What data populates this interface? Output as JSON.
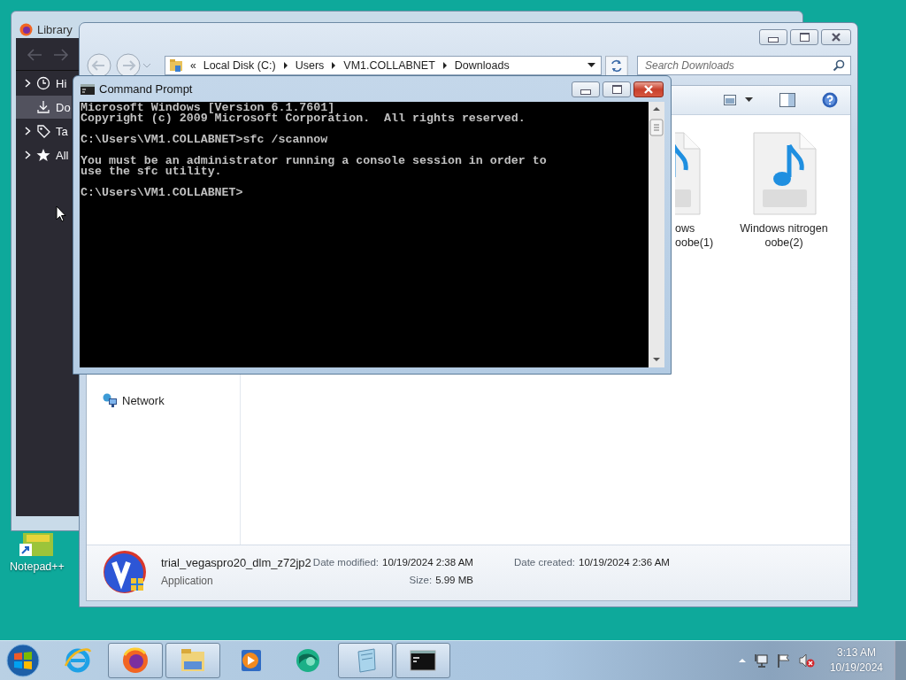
{
  "library_window": {
    "title": "Library",
    "sidebar": {
      "items": [
        {
          "label": "Hi",
          "expandable": true,
          "selected": false
        },
        {
          "label": "Do",
          "expandable": false,
          "selected": true
        },
        {
          "label": "Ta",
          "expandable": true,
          "selected": false
        },
        {
          "label": "All",
          "expandable": true,
          "selected": false
        }
      ]
    }
  },
  "explorer_window": {
    "address_bar": {
      "overflow": "«",
      "crumbs": [
        "Local Disk (C:)",
        "Users",
        "VM1.COLLABNET",
        "Downloads"
      ]
    },
    "search": {
      "placeholder": "Search Downloads"
    },
    "navigation_pane": {
      "items": [
        {
          "label": "Network"
        }
      ]
    },
    "files": [
      {
        "label": "ows oobe(1)"
      },
      {
        "label": "Windows nitrogen oobe(2)"
      }
    ],
    "details_pane": {
      "name": "trial_vegaspro20_dlm_z72jp2",
      "type": "Application",
      "properties": [
        {
          "label": "Date modified:",
          "value": "10/19/2024 2:38 AM"
        },
        {
          "label": "Size:",
          "value": "5.99 MB"
        },
        {
          "label": "Date created:",
          "value": "10/19/2024 2:36 AM"
        }
      ]
    }
  },
  "command_prompt_window": {
    "title": "Command Prompt",
    "console_blocks": [
      [
        "Microsoft Windows [Version 6.1.7601]",
        "Copyright (c) 2009 Microsoft Corporation.  All rights reserved."
      ],
      [
        "C:\\Users\\VM1.COLLABNET>sfc /scannow"
      ],
      [
        "You must be an administrator running a console session in order to",
        "use the sfc utility."
      ],
      [
        "C:\\Users\\VM1.COLLABNET>"
      ]
    ]
  },
  "desktop": {
    "icons": [
      {
        "label": "Notepad++"
      }
    ]
  },
  "taskbar": {
    "items": [
      {
        "running": false
      },
      {
        "running": true
      },
      {
        "running": true
      },
      {
        "running": false
      },
      {
        "running": false
      },
      {
        "running": true
      },
      {
        "running": true
      }
    ],
    "clock": {
      "time": "3:13 AM",
      "date": "10/19/2024"
    }
  }
}
